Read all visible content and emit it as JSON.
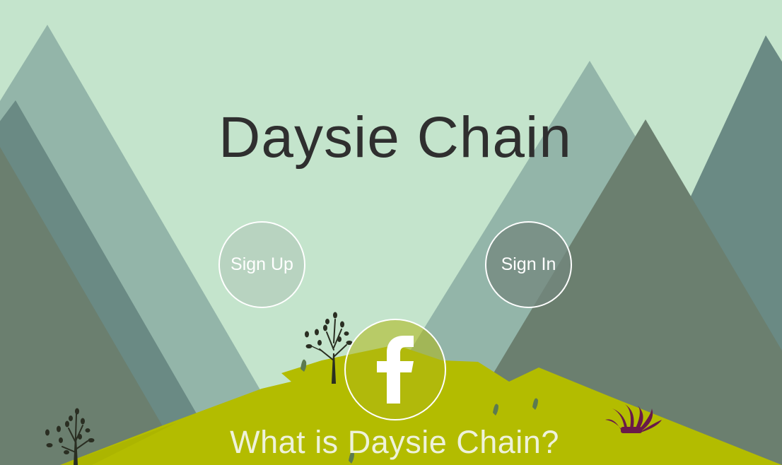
{
  "site": {
    "title": "Daysie Chain"
  },
  "actions": {
    "sign_up_label": "Sign Up",
    "sign_in_label": "Sign In",
    "facebook_icon": "facebook-icon"
  },
  "section": {
    "heading": "What is Daysie Chain?"
  },
  "colors": {
    "sky": "#c4e4cc",
    "mountain_light": "#93b5a9",
    "mountain_teal": "#6a8a84",
    "mountain_dark": "#6b7f6f",
    "hill": "#b3bc00",
    "title_text": "#2f2f2f",
    "button_border": "#ffffff"
  }
}
